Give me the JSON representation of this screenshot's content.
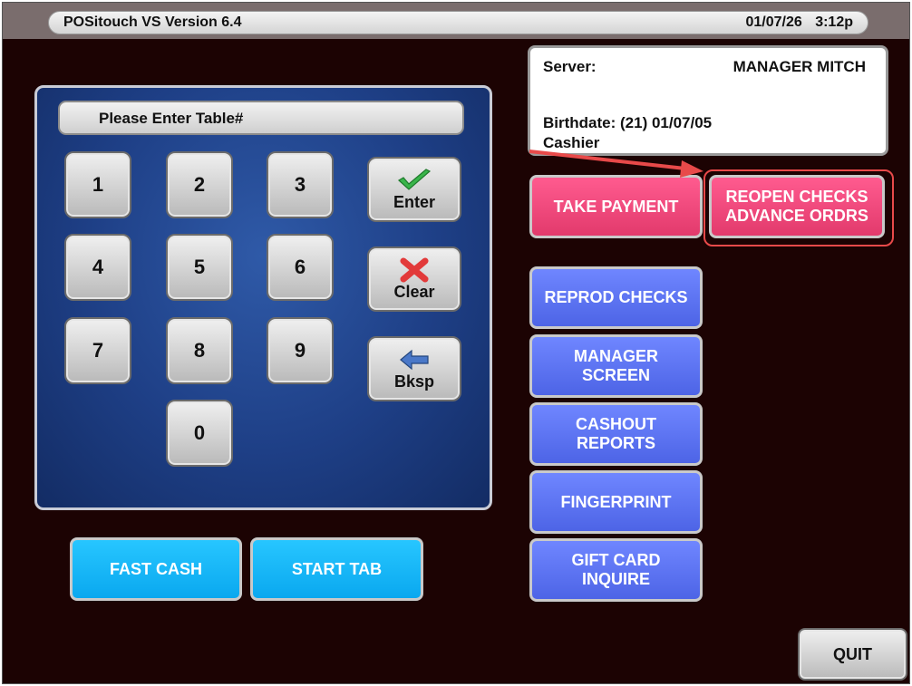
{
  "titlebar": {
    "app_title": "POSitouch VS Version 6.4",
    "date": "01/07/26",
    "time": "3:12p"
  },
  "keypad": {
    "prompt": "Please Enter Table#",
    "digits": [
      "1",
      "2",
      "3",
      "4",
      "5",
      "6",
      "7",
      "8",
      "9",
      "0"
    ],
    "enter_label": "Enter",
    "clear_label": "Clear",
    "bksp_label": "Bksp"
  },
  "server_info": {
    "server_label": "Server:",
    "server_name": "MANAGER MITCH",
    "birthdate": "Birthdate: (21) 01/07/05",
    "role": "Cashier"
  },
  "actions": {
    "take_payment": "TAKE  PAYMENT",
    "reopen_checks_line1": "REOPEN CHECKS",
    "reopen_checks_line2": "ADVANCE ORDRS",
    "reprod_checks": "REPROD CHECKS",
    "manager_screen_line1": "MANAGER",
    "manager_screen_line2": "SCREEN",
    "cashout_reports_line1": "CASHOUT",
    "cashout_reports_line2": "REPORTS",
    "fingerprint": "FINGERPRINT",
    "gift_card_line1": "GIFT CARD",
    "gift_card_line2": "INQUIRE",
    "fast_cash": "FAST CASH",
    "start_tab": "START TAB",
    "quit": "QUIT"
  },
  "colors": {
    "background": "#1c0303",
    "pink_button": "#f04a7d",
    "purple_button": "#5d75f5",
    "cyan_button": "#19b8f8",
    "annotation_red": "#e84a4a"
  },
  "icons": {
    "enter": "green-check-icon",
    "clear": "red-x-icon",
    "bksp": "blue-left-arrow-icon"
  }
}
